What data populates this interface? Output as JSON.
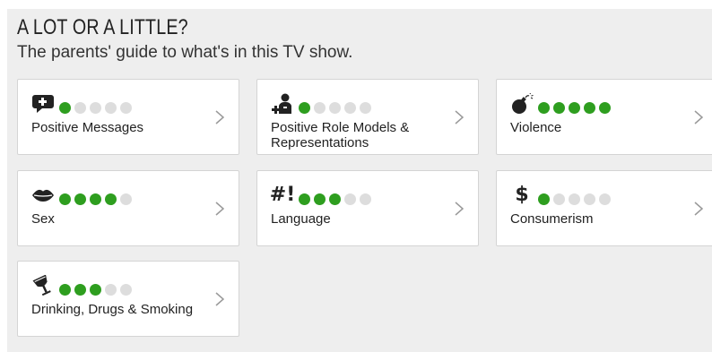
{
  "header": {
    "title": "A LOT OR A LITTLE?",
    "subtitle": "The parents' guide to what's in this TV show."
  },
  "colors": {
    "dot_on": "#2e9e1f",
    "dot_off": "#dddddd"
  },
  "categories": [
    {
      "label": "Positive Messages",
      "icon": "speech-bubble-plus-icon",
      "rating": 1,
      "max": 5
    },
    {
      "label": "Positive Role Models & Representations",
      "icon": "role-model-icon",
      "rating": 1,
      "max": 5
    },
    {
      "label": "Violence",
      "icon": "bomb-icon",
      "rating": 5,
      "max": 5
    },
    {
      "label": "Sex",
      "icon": "lips-icon",
      "rating": 4,
      "max": 5
    },
    {
      "label": "Language",
      "icon": "hash-exclamation-icon",
      "glyph": "#!",
      "rating": 3,
      "max": 5
    },
    {
      "label": "Consumerism",
      "icon": "dollar-icon",
      "glyph": "$",
      "rating": 1,
      "max": 5
    },
    {
      "label": "Drinking, Drugs & Smoking",
      "icon": "wine-glass-icon",
      "rating": 3,
      "max": 5
    }
  ]
}
